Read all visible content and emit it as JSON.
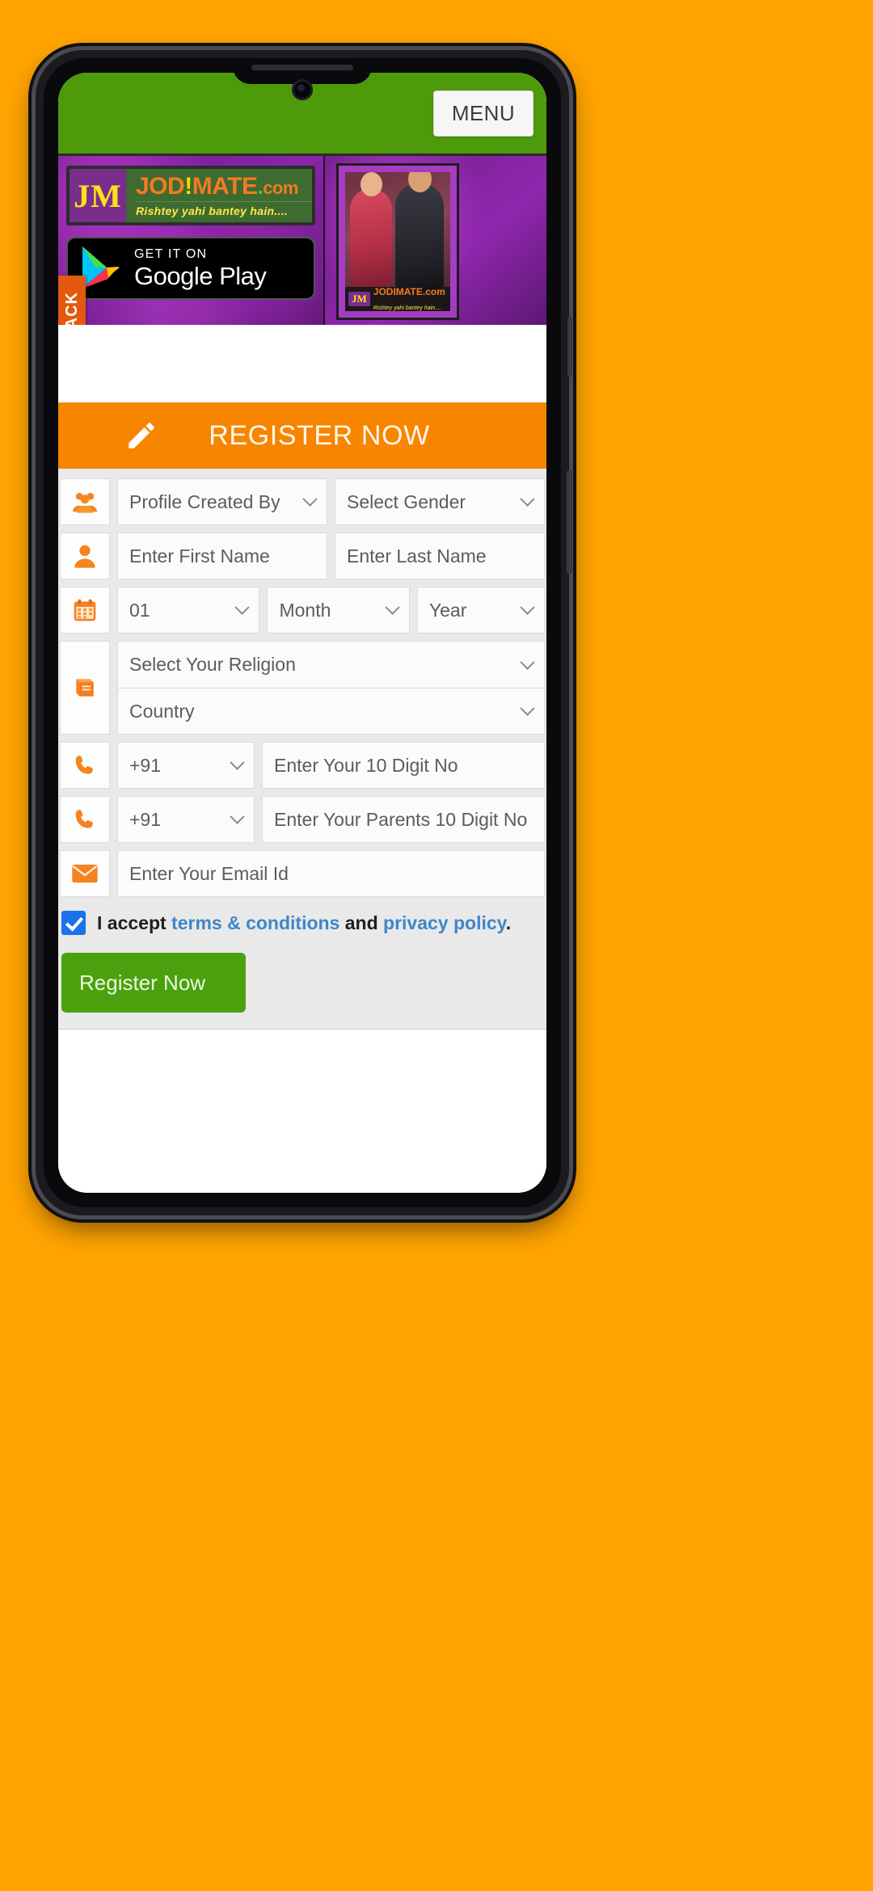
{
  "theme": {
    "page_background": "#FFA400",
    "header_green": "#4d9a0a",
    "banner_purple": "#8a25a8",
    "register_orange": "#F78500",
    "accent_orange": "#F47B20",
    "button_green": "#4ba10d",
    "link_blue": "#3f86c9",
    "checkbox_blue": "#1a73e8"
  },
  "header": {
    "menu_label": "MENU"
  },
  "banner": {
    "logo": {
      "monogram": "JM",
      "name_part1": "JOD",
      "name_bang": "!",
      "name_part2": "MATE",
      "dot": ".",
      "name_tld": "com",
      "tagline": "Rishtey yahi bantey hain...."
    },
    "google_play": {
      "top_line": "GET IT ON",
      "bottom_line": "Google Play"
    },
    "photo_card": {
      "badge_monogram": "JM",
      "badge_name": "JODIMATE.com",
      "badge_tagline": "Rishtey yahi bantey hain...."
    }
  },
  "feedback_tab": {
    "label": "FEEDBACK"
  },
  "register_banner": {
    "title": "REGISTER NOW"
  },
  "form": {
    "row_profile": {
      "icon": "users-icon",
      "created_by": "Profile Created By",
      "gender": "Select Gender"
    },
    "row_name": {
      "icon": "person-icon",
      "first_name": "Enter First Name",
      "last_name": "Enter Last Name"
    },
    "row_dob": {
      "icon": "calendar-icon",
      "day": "01",
      "month": "Month",
      "year": "Year"
    },
    "row_religion": {
      "icon": "book-icon",
      "religion": "Select Your Religion",
      "country": "Country"
    },
    "row_phone": {
      "icon": "phone-icon",
      "code": "+91",
      "number": "Enter Your 10 Digit No"
    },
    "row_parent_phone": {
      "icon": "phone-icon",
      "code": "+91",
      "number": "Enter Your Parents 10 Digit No"
    },
    "row_email": {
      "icon": "envelope-icon",
      "email": "Enter Your Email Id"
    },
    "terms": {
      "prefix": "I accept",
      "terms_link": "terms & conditions",
      "conjunction": "and",
      "privacy_link": "privacy policy",
      "suffix": "."
    },
    "submit_label": "Register Now"
  }
}
